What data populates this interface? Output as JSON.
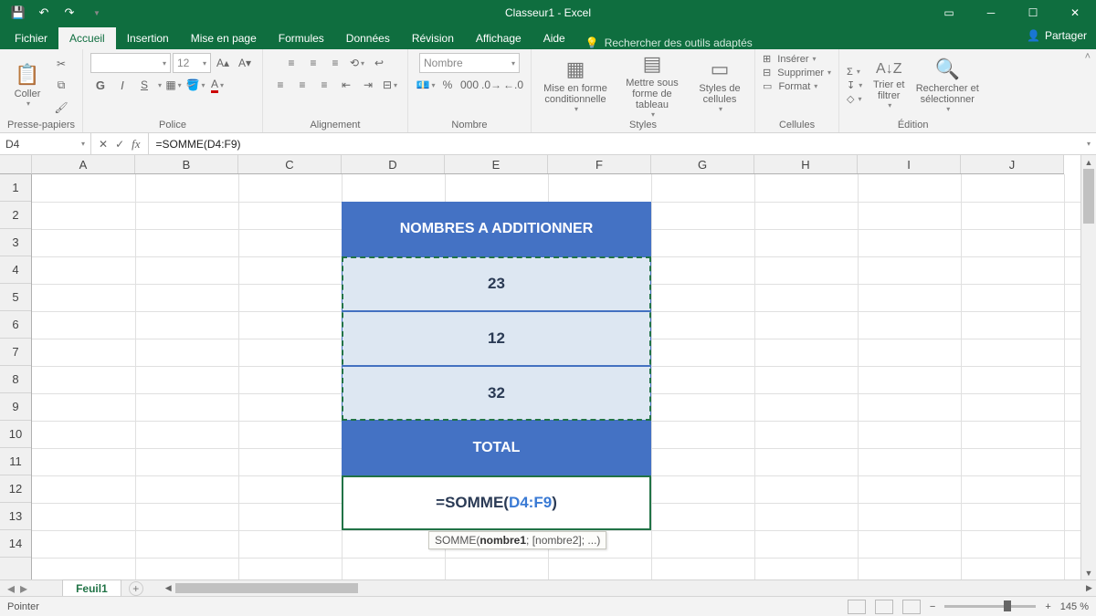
{
  "app": {
    "title": "Classeur1  -  Excel"
  },
  "qat": {
    "save": "💾",
    "undo": "↶",
    "redo": "↷"
  },
  "tabs": {
    "fichier": "Fichier",
    "accueil": "Accueil",
    "insertion": "Insertion",
    "miseenpage": "Mise en page",
    "formules": "Formules",
    "donnees": "Données",
    "revision": "Révision",
    "affichage": "Affichage",
    "aide": "Aide",
    "tellme": "Rechercher des outils adaptés",
    "partager": "Partager"
  },
  "ribbon": {
    "presse": {
      "label": "Presse-papiers",
      "coller": "Coller"
    },
    "police": {
      "label": "Police",
      "font": "",
      "size": "12",
      "g": "G",
      "i": "I",
      "s": "S"
    },
    "alignement": {
      "label": "Alignement"
    },
    "nombre": {
      "label": "Nombre",
      "format": "Nombre"
    },
    "styles": {
      "label": "Styles",
      "cond": "Mise en forme conditionnelle",
      "table": "Mettre sous forme de tableau",
      "cell": "Styles de cellules"
    },
    "cellules": {
      "label": "Cellules",
      "inserer": "Insérer",
      "supprimer": "Supprimer",
      "format": "Format"
    },
    "edition": {
      "label": "Édition",
      "trier": "Trier et filtrer",
      "rechercher": "Rechercher et sélectionner"
    }
  },
  "namebox": "D4",
  "formulabar": "=SOMME(D4:F9)",
  "columns": [
    "A",
    "B",
    "C",
    "D",
    "E",
    "F",
    "G",
    "H",
    "I",
    "J"
  ],
  "rows": [
    "1",
    "2",
    "3",
    "4",
    "5",
    "6",
    "7",
    "8",
    "9",
    "10",
    "11",
    "12",
    "13",
    "14"
  ],
  "content": {
    "header1": "NOMBRES A ADDITIONNER",
    "val1": "23",
    "val2": "12",
    "val3": "32",
    "total_label": "TOTAL",
    "formula_prefix": "=SOMME(",
    "formula_ref": "D4:F9",
    "formula_suffix": ")",
    "tooltip_fn": "SOMME(",
    "tooltip_b": "nombre1",
    "tooltip_rest": "; [nombre2]; ...)"
  },
  "sheet_tab": "Feuil1",
  "status": {
    "mode": "Pointer",
    "zoom": "145 %"
  }
}
